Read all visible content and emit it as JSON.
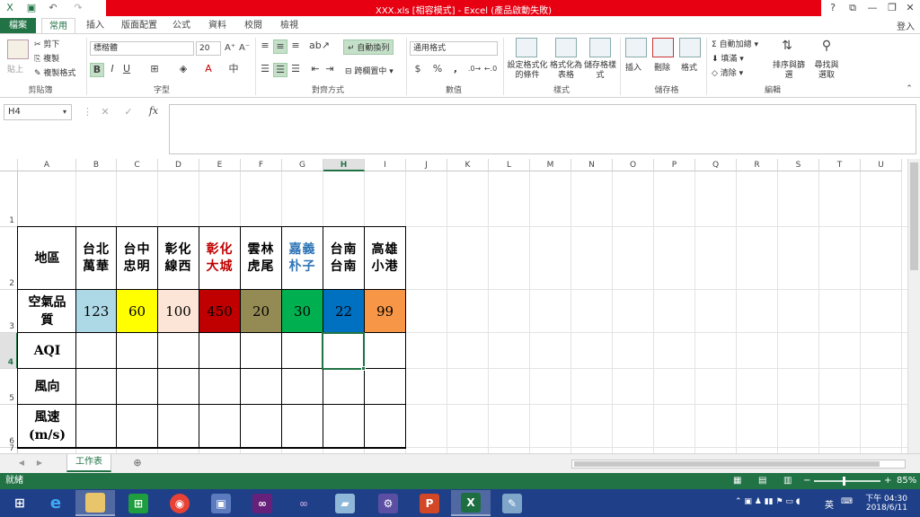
{
  "window": {
    "title": "XXX.xls [相容模式] - Excel (產品啟動失敗)",
    "login": "登入",
    "controls": [
      "?",
      "⧉",
      "—",
      "❐",
      "✕"
    ]
  },
  "ribbon_tabs": [
    "檔案",
    "常用",
    "插入",
    "版面配置",
    "公式",
    "資料",
    "校閱",
    "檢視"
  ],
  "ribbon": {
    "clipboard": {
      "paste": "貼上",
      "cut": "剪下",
      "copy": "複製",
      "format_painter": "複製格式",
      "label": "剪貼簿"
    },
    "font": {
      "name": "標楷體",
      "size": "20",
      "label": "字型",
      "bold": "B",
      "italic": "I",
      "underline": "U"
    },
    "alignment": {
      "wrap": "自動換列",
      "merge": "跨欄置中",
      "label": "對齊方式"
    },
    "number": {
      "format": "通用格式",
      "currency": "$",
      "percent": "%",
      "comma": ",",
      "label": "數值"
    },
    "styles": {
      "conditional": "設定格式化的條件",
      "as_table": "格式化為表格",
      "cell_styles": "儲存格樣式",
      "label": "樣式"
    },
    "cells": {
      "insert": "插入",
      "delete": "刪除",
      "format": "格式",
      "label": "儲存格"
    },
    "editing": {
      "autosum": "自動加總",
      "fill": "填滿",
      "clear": "清除",
      "sort": "排序與篩選",
      "find": "尋找與選取",
      "label": "編輯"
    }
  },
  "formula_bar": {
    "name_box": "H4",
    "fx": "fx",
    "content": ""
  },
  "columns": [
    "A",
    "B",
    "C",
    "D",
    "E",
    "F",
    "G",
    "H",
    "I",
    "J",
    "K",
    "L",
    "M",
    "N",
    "O",
    "P",
    "Q",
    "R",
    "S",
    "T",
    "U"
  ],
  "selected_column": "H",
  "rows": [
    "1",
    "2",
    "3",
    "4",
    "5",
    "6",
    "7"
  ],
  "selected_row": "4",
  "table": {
    "header_label": "地區",
    "stations": [
      {
        "top": "台北",
        "bottom": "萬華",
        "color": "#000000",
        "aqi": "123",
        "bg": "#add8e6"
      },
      {
        "top": "台中",
        "bottom": "忠明",
        "color": "#000000",
        "aqi": "60",
        "bg": "#ffff00"
      },
      {
        "top": "彰化",
        "bottom": "線西",
        "color": "#000000",
        "aqi": "100",
        "bg": "#fce4d6"
      },
      {
        "top": "彰化",
        "bottom": "大城",
        "color": "#c00000",
        "aqi": "450",
        "bg": "#c00000"
      },
      {
        "top": "雲林",
        "bottom": "虎尾",
        "color": "#000000",
        "aqi": "20",
        "bg": "#948a54"
      },
      {
        "top": "嘉義",
        "bottom": "朴子",
        "color": "#2e75b6",
        "aqi": "30",
        "bg": "#00b050"
      },
      {
        "top": "台南",
        "bottom": "台南",
        "color": "#000000",
        "aqi": "22",
        "bg": "#0070c0"
      },
      {
        "top": "高雄",
        "bottom": "小港",
        "color": "#000000",
        "aqi": "99",
        "bg": "#f79646"
      }
    ],
    "row_labels": [
      {
        "line1": "空氣品",
        "line2": "質"
      },
      {
        "line1": "AQI",
        "line2": ""
      },
      {
        "line1": "風向",
        "line2": ""
      },
      {
        "line1": "風速",
        "line2": "(m/s)"
      }
    ]
  },
  "sheet_tab": "工作表",
  "status": {
    "mode": "就緒",
    "zoom": "85%"
  },
  "clock": {
    "time": "下午 04:30",
    "date": "2018/6/11"
  },
  "tray": {
    "ime": "英"
  }
}
